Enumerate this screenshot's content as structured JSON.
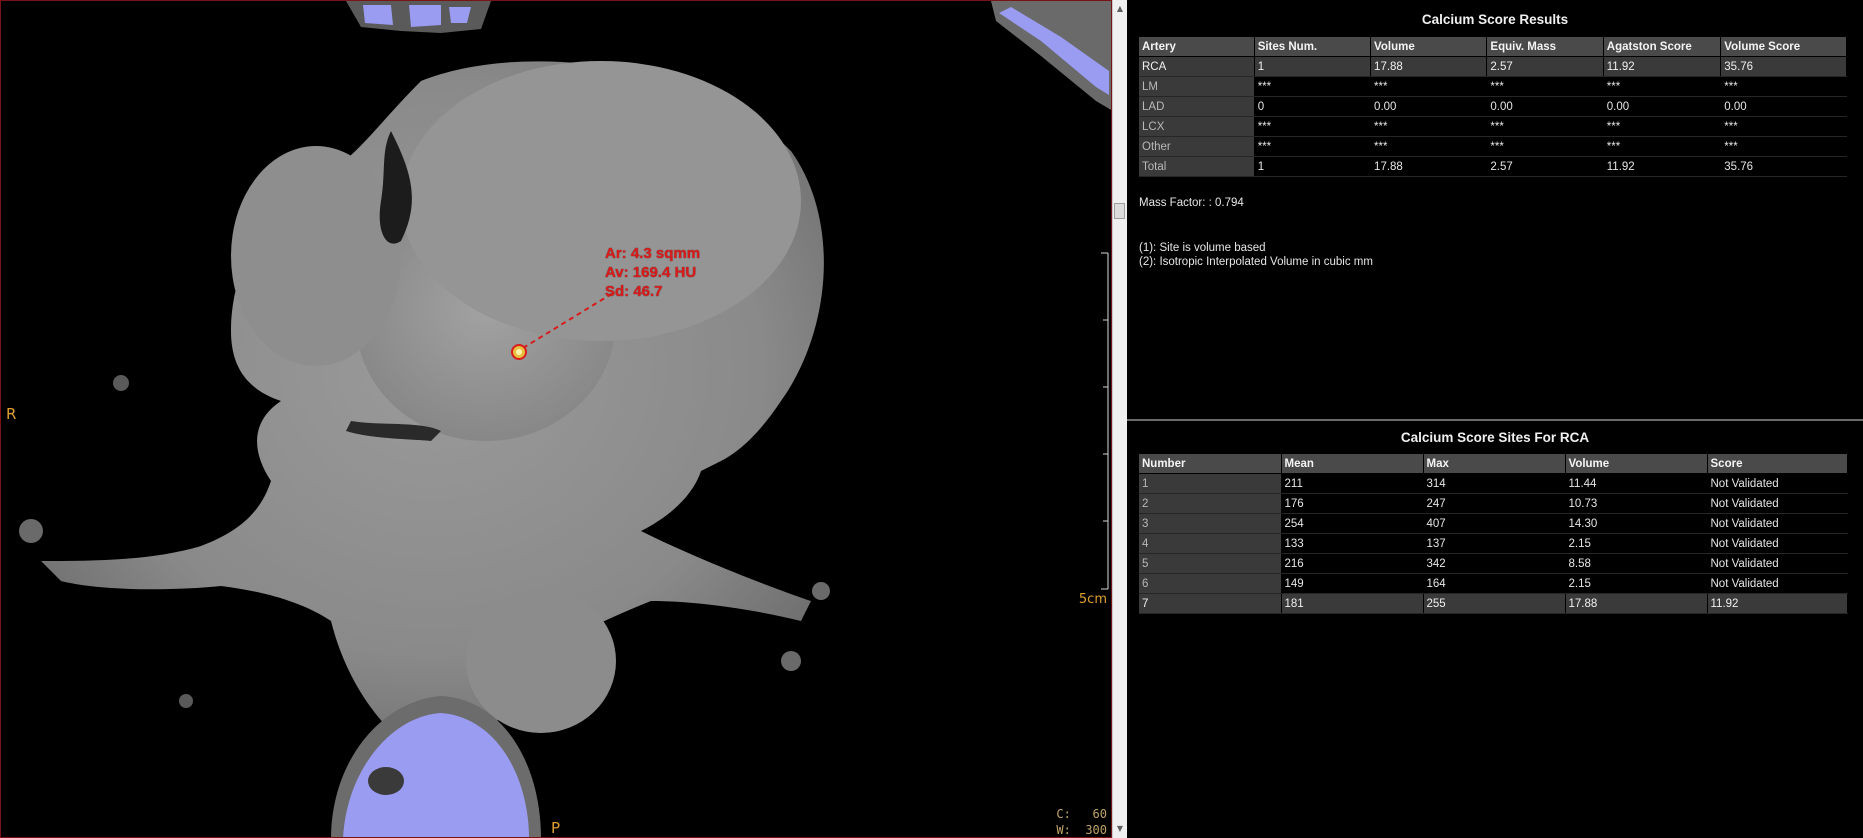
{
  "viewer": {
    "orientation_left": "R",
    "orientation_bottom": "P",
    "scale_label": "5cm",
    "window_center": "C:   60",
    "window_width": "W:  300",
    "measurement": {
      "area": "Ar: 4.3 sqmm",
      "average": "Av: 169.4 HU",
      "std_dev": "Sd: 46.7"
    },
    "colors": {
      "annotation": "#d81c1c",
      "overlay_calcium": "#9a9cf2",
      "lesion": "#e8c040",
      "border": "#7a1414"
    }
  },
  "score_results": {
    "title": "Calcium Score Results",
    "columns": [
      "Artery",
      "Sites Num.",
      "Volume",
      "Equiv. Mass",
      "Agatston Score",
      "Volume Score"
    ],
    "rows": [
      {
        "artery": "RCA",
        "sites": "1",
        "volume": "17.88",
        "mass": "2.57",
        "agatston": "11.92",
        "volume_score": "35.76",
        "highlight": true
      },
      {
        "artery": "LM",
        "sites": "***",
        "volume": "***",
        "mass": "***",
        "agatston": "***",
        "volume_score": "***"
      },
      {
        "artery": "LAD",
        "sites": "0",
        "volume": "0.00",
        "mass": "0.00",
        "agatston": "0.00",
        "volume_score": "0.00"
      },
      {
        "artery": "LCX",
        "sites": "***",
        "volume": "***",
        "mass": "***",
        "agatston": "***",
        "volume_score": "***"
      },
      {
        "artery": "Other",
        "sites": "***",
        "volume": "***",
        "mass": "***",
        "agatston": "***",
        "volume_score": "***"
      },
      {
        "artery": "Total",
        "sites": "1",
        "volume": "17.88",
        "mass": "2.57",
        "agatston": "11.92",
        "volume_score": "35.76"
      }
    ],
    "mass_factor": "Mass Factor: : 0.794",
    "footnote_1": "(1): Site is volume based",
    "footnote_2": "(2): Isotropic Interpolated Volume in cubic mm"
  },
  "sites": {
    "title": "Calcium Score Sites For RCA",
    "columns": [
      "Number",
      "Mean",
      "Max",
      "Volume",
      "Score"
    ],
    "rows": [
      {
        "number": "1",
        "mean": "211",
        "max": "314",
        "volume": "11.44",
        "score": "Not Validated"
      },
      {
        "number": "2",
        "mean": "176",
        "max": "247",
        "volume": "10.73",
        "score": "Not Validated"
      },
      {
        "number": "3",
        "mean": "254",
        "max": "407",
        "volume": "14.30",
        "score": "Not Validated"
      },
      {
        "number": "4",
        "mean": "133",
        "max": "137",
        "volume": "2.15",
        "score": "Not Validated"
      },
      {
        "number": "5",
        "mean": "216",
        "max": "342",
        "volume": "8.58",
        "score": "Not Validated"
      },
      {
        "number": "6",
        "mean": "149",
        "max": "164",
        "volume": "2.15",
        "score": "Not Validated"
      },
      {
        "number": "7",
        "mean": "181",
        "max": "255",
        "volume": "17.88",
        "score": "11.92",
        "highlight": true
      }
    ]
  }
}
